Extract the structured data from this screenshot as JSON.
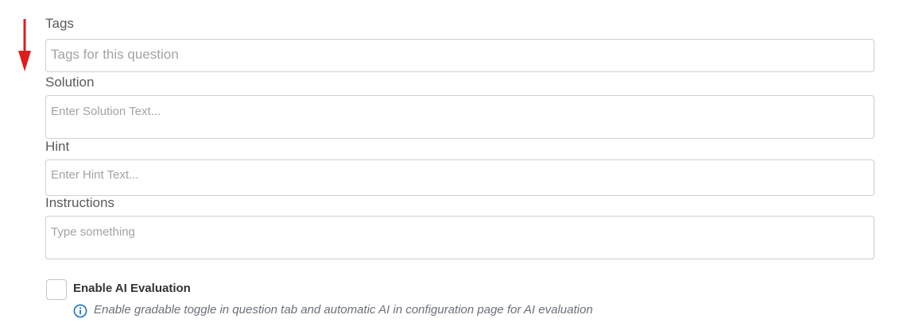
{
  "annotation": {
    "arrow_color": "#e01b1b",
    "arrow_icon": "arrow-down-icon"
  },
  "form": {
    "tags": {
      "label": "Tags",
      "placeholder": "Tags for this question"
    },
    "solution": {
      "label": "Solution",
      "placeholder": "Enter Solution Text..."
    },
    "hint": {
      "label": "Hint",
      "placeholder": "Enter Hint Text..."
    },
    "instructions": {
      "label": "Instructions",
      "placeholder": "Type something"
    },
    "ai_evaluation": {
      "label": "Enable AI Evaluation",
      "checked": false,
      "info_icon": "info-circle-icon",
      "info_color": "#1a73c8",
      "help_text": "Enable gradable toggle in question tab and automatic AI in configuration page for AI evaluation"
    }
  }
}
